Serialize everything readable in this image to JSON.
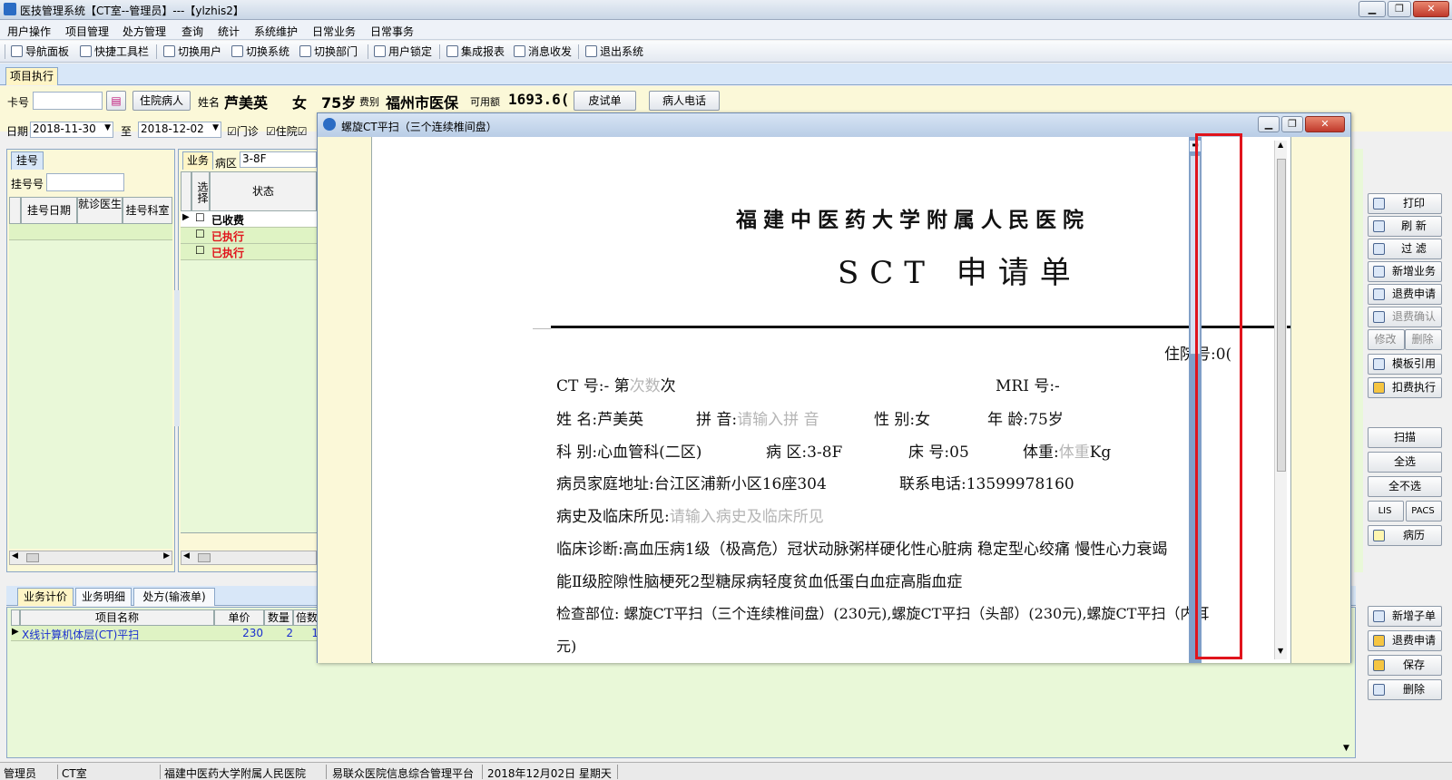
{
  "window": {
    "title": "医技管理系统【CT室--管理员】---【ylzhis2】"
  },
  "menu": [
    "用户操作",
    "项目管理",
    "处方管理",
    "查询",
    "统计",
    "系统维护",
    "日常业务",
    "日常事务"
  ],
  "toolbar": [
    "导航面板",
    "快捷工具栏",
    "切换用户",
    "切换系统",
    "切换部门",
    "用户锁定",
    "集成报表",
    "消息收发",
    "退出系统"
  ],
  "main_tab": "项目执行",
  "patient": {
    "card_label": "卡号",
    "inpatient_btn": "住院病人",
    "name_label": "姓名",
    "name": "芦美英",
    "sex": "女",
    "age": "75岁",
    "fee_label": "费别",
    "fee_type": "福州市医保",
    "avail_label": "可用额",
    "available": "1693.6(",
    "skin_test_btn": "皮试单",
    "phone_btn": "病人电话"
  },
  "filter": {
    "date_label": "日期",
    "date_from": "2018-11-30",
    "to_label": "至",
    "date_to": "2018-12-02",
    "outpatient": "门诊",
    "inpatient": "住院"
  },
  "registration": {
    "tab": "挂号",
    "reg_no_label": "挂号号",
    "columns": [
      "挂号日期",
      "就诊医生",
      "挂号科室"
    ]
  },
  "business": {
    "tab": "业务",
    "ward_label": "病区",
    "ward": "3-8F",
    "col_select": "选择",
    "col_status": "状态",
    "rows": [
      "已收费",
      "已执行",
      "已执行"
    ]
  },
  "bottom_tabs": [
    "业务计价",
    "业务明细",
    "处方(输液单)"
  ],
  "pricing_grid": {
    "columns": [
      "项目名称",
      "单价",
      "数量",
      "倍数"
    ],
    "rows": [
      {
        "name": "X线计算机体层(CT)平扫",
        "price": "230",
        "qty": "2",
        "mult": "1"
      }
    ]
  },
  "side_buttons_top": [
    "打印",
    "刷 新",
    "过 滤",
    "新增业务",
    "退费申请",
    "退费确认",
    "修改",
    "删除",
    "模板引用",
    "扣费执行"
  ],
  "side_buttons_mid": [
    "扫描",
    "全选",
    "全不选",
    "LIS",
    "PACS",
    "病历"
  ],
  "side_buttons_bottom": [
    "新增子单",
    "退费申请",
    "保存",
    "删除"
  ],
  "dialog": {
    "title": "螺旋CT平扫（三个连续椎间盘）",
    "hospital": "福建中医药大学附属人民医院",
    "form_title": "SCT 申请单",
    "inpatient_no": "住院号:0(",
    "ct_no": "CT 号:- 第",
    "times_ph": "次数",
    "times_suffix": "次",
    "mri_no": "MRI 号:-",
    "name": "姓 名:芦美英",
    "pinyin_label": "拼 音:",
    "pinyin_ph": "请输入拼 音",
    "sex": "性 别:女",
    "age": "年 龄:75岁",
    "dept": "科 别:心血管科(二区)",
    "ward": "病 区:3-8F",
    "bed": "床 号:05",
    "weight_label": "体重:",
    "weight_ph": "体重",
    "weight_unit": "Kg",
    "address": "病员家庭地址:台江区浦新小区16座304",
    "phone": "联系电话:13599978160",
    "history_label": "病史及临床所见:",
    "history_ph": "请输入病史及临床所见",
    "diagnosis_1": "临床诊断:高血压病1级（极高危）冠状动脉粥样硬化性心脏病 稳定型心绞痛 慢性心力衰竭",
    "diagnosis_2": "能Ⅱ级腔隙性脑梗死2型糖尿病轻度贫血低蛋白血症高脂血症",
    "exam_1": "检查部位: 螺旋CT平扫（三个连续椎间盘）(230元),螺旋CT平扫（头部）(230元),螺旋CT平扫（内耳",
    "exam_2": "元)"
  },
  "status": [
    "管理员",
    "CT室",
    "福建中医药大学附属人民医院",
    "易联众医院信息综合管理平台",
    "2018年12月02日 星期天"
  ],
  "highlight_color": "#e0141c"
}
